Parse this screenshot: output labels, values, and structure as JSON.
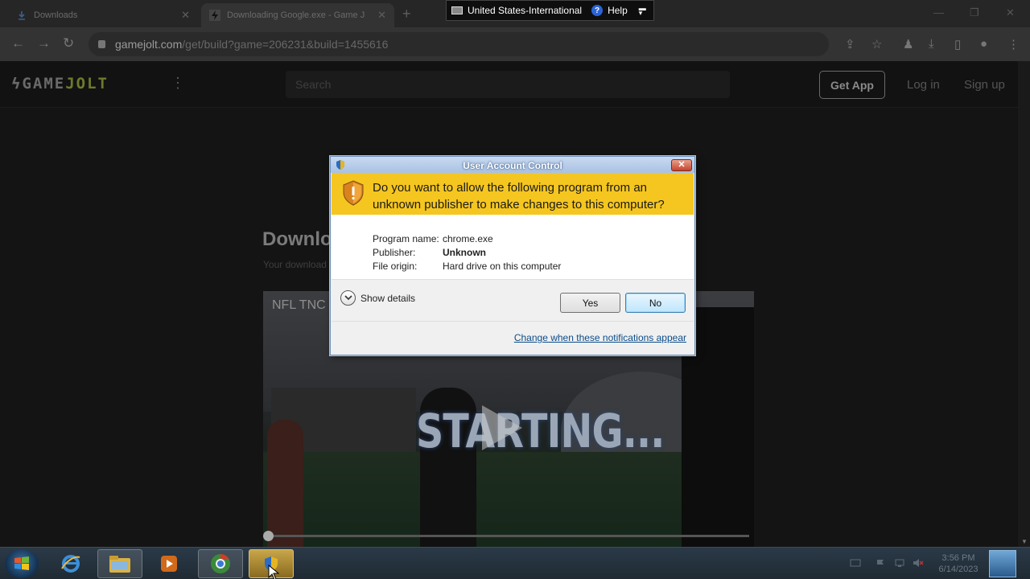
{
  "browser": {
    "tabs": [
      {
        "title": "Downloads",
        "icon": "download-icon"
      },
      {
        "title": "Downloading Google.exe - Game J",
        "icon": "gamejolt-favicon"
      }
    ],
    "new_tab": "+",
    "url_host": "gamejolt.com",
    "url_path": "/get/build?game=206231&build=1455616"
  },
  "language_bar": {
    "language": "United States-International",
    "help": "Help"
  },
  "site": {
    "logo_prefix": "GAME",
    "logo_suffix": "JOLT",
    "search_placeholder": "Search",
    "get_app": "Get App",
    "login": "Log in",
    "signup": "Sign up",
    "heading": "Downlo",
    "subheading": "Your download",
    "video_label": "NFL TNC",
    "video_overlay": "STARTING..."
  },
  "uac": {
    "title": "User Account Control",
    "close": "✕",
    "question": "Do you want to allow the following program from an unknown publisher to make changes to this computer?",
    "program_name_label": "Program name:",
    "program_name": "chrome.exe",
    "publisher_label": "Publisher:",
    "publisher": "Unknown",
    "file_origin_label": "File origin:",
    "file_origin": "Hard drive on this computer",
    "show_details": "Show details",
    "yes": "Yes",
    "no": "No",
    "change_link": "Change when these notifications appear"
  },
  "taskbar": {
    "time": "3:56 PM",
    "date": "6/14/2023"
  },
  "colors": {
    "uac_banner": "#f5c61f",
    "uac_link": "#0b4c8a",
    "taskbar": "#1f2a33"
  }
}
